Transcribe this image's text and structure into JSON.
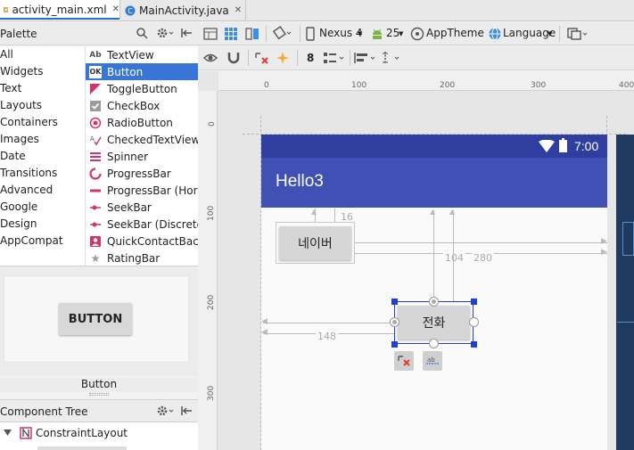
{
  "tabs": [
    {
      "label": "activity_main.xml",
      "icon": "layout-xml-icon",
      "active": true
    },
    {
      "label": "MainActivity.java",
      "icon": "java-class-icon",
      "active": false
    }
  ],
  "palette": {
    "title": "Palette",
    "categories": [
      "All",
      "Widgets",
      "Text",
      "Layouts",
      "Containers",
      "Images",
      "Date",
      "Transitions",
      "Advanced",
      "Google",
      "Design",
      "AppCompat"
    ],
    "items": [
      {
        "label": "TextView",
        "icon": "textview-icon"
      },
      {
        "label": "Button",
        "icon": "button-icon",
        "selected": true
      },
      {
        "label": "ToggleButton",
        "icon": "toggle-button-icon"
      },
      {
        "label": "CheckBox",
        "icon": "checkbox-icon"
      },
      {
        "label": "RadioButton",
        "icon": "radio-button-icon"
      },
      {
        "label": "CheckedTextView",
        "icon": "checked-textview-icon"
      },
      {
        "label": "Spinner",
        "icon": "spinner-icon"
      },
      {
        "label": "ProgressBar",
        "icon": "progressbar-icon"
      },
      {
        "label": "ProgressBar (Hor",
        "icon": "progressbar-horizontal-icon"
      },
      {
        "label": "SeekBar",
        "icon": "seekbar-icon"
      },
      {
        "label": "SeekBar (Discrete",
        "icon": "seekbar-discrete-icon"
      },
      {
        "label": "QuickContactBac",
        "icon": "quick-contact-badge-icon"
      },
      {
        "label": "RatingBar",
        "icon": "ratingbar-icon"
      }
    ],
    "preview_button_label": "BUTTON",
    "preview_caption": "Button"
  },
  "component_tree": {
    "title": "Component Tree",
    "root": "ConstraintLayout"
  },
  "toolbar": {
    "device": "Nexus 4",
    "api": "25",
    "theme": "AppTheme",
    "language": "Language",
    "margin_value": "8"
  },
  "rulers": {
    "h": [
      "0",
      "100",
      "200",
      "300",
      "400"
    ],
    "v": [
      "0",
      "100",
      "200",
      "300"
    ]
  },
  "phone": {
    "time": "7:00",
    "app_title": "Hello3",
    "button_naver": "네이버",
    "button_call": "전화",
    "dims": {
      "d16": "16",
      "d104": "104",
      "d280": "280",
      "d148": "148"
    }
  },
  "colors": {
    "status_bar": "#303f9f",
    "app_bar": "#3f51b5",
    "selection": "#3875d7",
    "handle": "#1f3fd6"
  }
}
